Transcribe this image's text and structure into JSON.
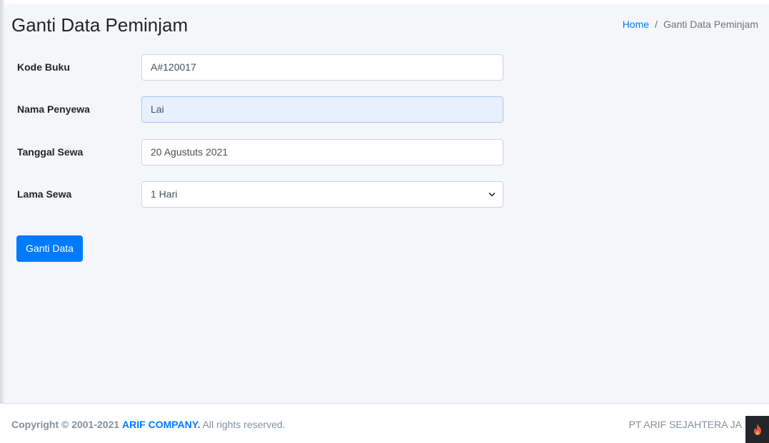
{
  "header": {
    "title": "Ganti Data Peminjam",
    "breadcrumb": {
      "home": "Home",
      "separator": "/",
      "current": "Ganti Data Peminjam"
    }
  },
  "form": {
    "fields": [
      {
        "label": "Kode Buku",
        "value": "A#120017"
      },
      {
        "label": "Nama Penyewa",
        "value": "Lai"
      },
      {
        "label": "Tanggal Sewa",
        "value": "20 Agustuts 2021"
      }
    ],
    "duration": {
      "label": "Lama Sewa",
      "selected": "1 Hari"
    },
    "submit_label": "Ganti Data"
  },
  "footer": {
    "copyright_prefix": "Copyright © 2001-2021",
    "company": "ARIF COMPANY.",
    "rights": "All rights reserved.",
    "right_text": "PT ARIF SEJAHTERA JA"
  },
  "colors": {
    "accent": "#007bff",
    "background": "#f4f6f9",
    "autofill": "#e8f0fe"
  },
  "icons": {
    "select_arrow": "chevron-down-icon",
    "corner_badge": "flame-icon"
  }
}
